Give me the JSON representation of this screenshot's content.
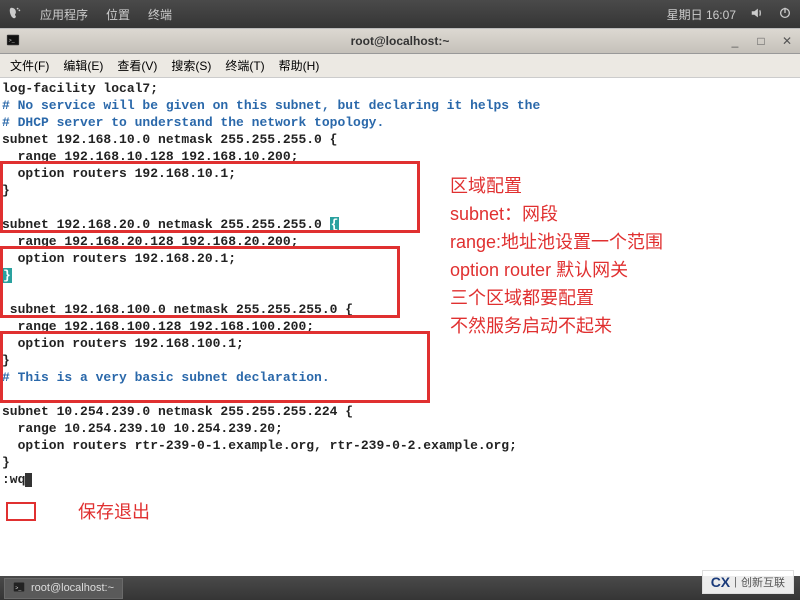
{
  "top_panel": {
    "app_menu": "应用程序",
    "places": "位置",
    "terminal_label": "终端",
    "weekday_time": "星期日 16:07"
  },
  "window": {
    "title": "root@localhost:~"
  },
  "menu": {
    "file": "文件(F)",
    "edit": "编辑(E)",
    "view": "查看(V)",
    "search": "搜索(S)",
    "terminal": "终端(T)",
    "help": "帮助(H)"
  },
  "code": {
    "l1": "log-facility local7;",
    "l2": "",
    "l3": "# No service will be given on this subnet, but declaring it helps the",
    "l4": "# DHCP server to understand the network topology.",
    "l5": "",
    "b1_1": "subnet 192.168.10.0 netmask 255.255.255.0 {",
    "b1_2": "  range 192.168.10.128 192.168.10.200;",
    "b1_3": "  option routers 192.168.10.1;",
    "b1_4": "}",
    "b2_1": "subnet 192.168.20.0 netmask 255.255.255.0 ",
    "b2_1b": "{",
    "b2_2": "  range 192.168.20.128 192.168.20.200;",
    "b2_3": "  option routers 192.168.20.1;",
    "b2_4": "}",
    "b3_1": " subnet 192.168.100.0 netmask 255.255.255.0 {",
    "b3_2": "  range 192.168.100.128 192.168.100.200;",
    "b3_3": "  option routers 192.168.100.1;",
    "b3_4": "}",
    "l_basic": "# This is a very basic subnet declaration.",
    "b4_1": "subnet 10.254.239.0 netmask 255.255.255.224 {",
    "b4_2": "  range 10.254.239.10 10.254.239.20;",
    "b4_3": "  option routers rtr-239-0-1.example.org, rtr-239-0-2.example.org;",
    "b4_4": "}",
    "wq": ":wq"
  },
  "annotations": {
    "a1": "区域配置",
    "a2": "subnet：网段",
    "a3": "range:地址池设置一个范围",
    "a4": "option router 默认网关",
    "a5": "三个区域都要配置",
    "a6": "不然服务启动不起来",
    "save": "保存退出"
  },
  "taskbar": {
    "item1": "root@localhost:~"
  },
  "watermark": {
    "brand": "创新互联"
  }
}
